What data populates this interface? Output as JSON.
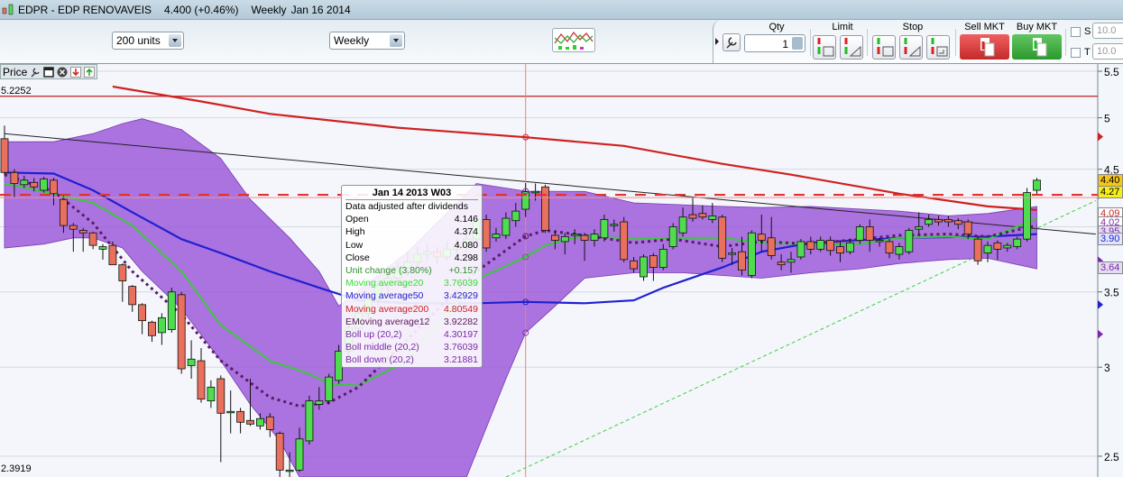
{
  "title": {
    "symbol": "EDPR - EDP RENOVAVEIS",
    "price": "4.400 (+0.46%)",
    "period": "Weekly",
    "date": "Jan 16 2014"
  },
  "toolbar": {
    "units_select": "200 units",
    "period_select": "Weekly",
    "indicators_button": "indicators"
  },
  "trade_panel": {
    "qty_label": "Qty",
    "qty_value": "1",
    "limit_label": "Limit",
    "stop_label": "Stop",
    "sell_label": "Sell MKT",
    "buy_label": "Buy MKT",
    "s_label": "S",
    "t_label": "T",
    "s_value": "10.0",
    "t_value": "10.0"
  },
  "price_panel": {
    "label": "Price",
    "max_label": "5.2252",
    "min_label": "2.3919"
  },
  "tooltip": {
    "header": "Jan 14 2013 W03",
    "note": "Data adjusted after dividends",
    "rows": [
      {
        "label": "Open",
        "value": "4.146",
        "color": "#000000"
      },
      {
        "label": "High",
        "value": "4.374",
        "color": "#000000"
      },
      {
        "label": "Low",
        "value": "4.080",
        "color": "#000000"
      },
      {
        "label": "Close",
        "value": "4.298",
        "color": "#000000"
      },
      {
        "label": "Unit change (3.80%)",
        "value": "+0.157",
        "color": "#2f8f2f"
      },
      {
        "label": "Moving average20",
        "value": "3.76039",
        "color": "#33dd33"
      },
      {
        "label": "Moving average50",
        "value": "3.42929",
        "color": "#2222cc"
      },
      {
        "label": "Moving average200",
        "value": "4.80549",
        "color": "#cc2222"
      },
      {
        "label": "EMoving average12",
        "value": "3.92282",
        "color": "#5a1a5a"
      },
      {
        "label": "Boll up (20,2)",
        "value": "4.30197",
        "color": "#7a2aa8"
      },
      {
        "label": "Boll middle (20,2)",
        "value": "3.76039",
        "color": "#7a2aa8"
      },
      {
        "label": "Boll down (20,2)",
        "value": "3.21881",
        "color": "#7a2aa8"
      }
    ]
  },
  "axis_labels": [
    {
      "text": "4.40",
      "bg": "#f6c51a",
      "color": "#000"
    },
    {
      "text": "4.27",
      "bg": "#f4ee1a",
      "color": "#000"
    },
    {
      "text": "4.09",
      "bg": "#ffffff",
      "color": "#cc2222"
    },
    {
      "text": "4.02",
      "bg": "#ffffff",
      "color": "#7a2aa8"
    },
    {
      "text": "3.95",
      "bg": "#e8dcf4",
      "color": "#7a2aa8"
    },
    {
      "text": "3.90",
      "bg": "#e0e6ff",
      "color": "#2222cc"
    },
    {
      "text": "3.64",
      "bg": "#e4dcf2",
      "color": "#7a2aa8"
    }
  ],
  "chart_data": {
    "type": "candlestick",
    "scale": "log",
    "ylim": [
      2.3919,
      5.58
    ],
    "yticks": [
      5.5,
      5,
      4.5,
      4,
      3.5,
      3,
      2.5
    ],
    "ytick_labels": [
      "5.5",
      "5",
      "4.5",
      "",
      "3.5",
      "3",
      "2.5"
    ],
    "colors": {
      "up": "#4fdc4f",
      "down": "#e8705c",
      "ma20": "#3cc83c",
      "ma50": "#2020d0",
      "ma200": "#d02020",
      "ema12": "#5a1a6a",
      "boll": "#9a55d8",
      "trend": "#222222",
      "support": "#44cc44",
      "level": "#dd3333"
    },
    "crosshair_index": 53,
    "level_price": 4.27,
    "max_line": 5.2252,
    "candles": [
      [
        4.79,
        4.92,
        4.45,
        4.47
      ],
      [
        4.47,
        4.5,
        4.25,
        4.37
      ],
      [
        4.36,
        4.44,
        4.33,
        4.4
      ],
      [
        4.38,
        4.42,
        4.3,
        4.34
      ],
      [
        4.31,
        4.43,
        4.29,
        4.41
      ],
      [
        4.4,
        4.42,
        4.18,
        4.28
      ],
      [
        4.23,
        4.26,
        3.95,
        4.01
      ],
      [
        4.01,
        4.03,
        3.8,
        3.98
      ],
      [
        3.97,
        3.99,
        3.8,
        3.95
      ],
      [
        3.95,
        3.96,
        3.82,
        3.85
      ],
      [
        3.82,
        3.86,
        3.74,
        3.84
      ],
      [
        3.85,
        3.88,
        3.72,
        3.7
      ],
      [
        3.7,
        3.71,
        3.43,
        3.58
      ],
      [
        3.54,
        3.55,
        3.36,
        3.41
      ],
      [
        3.41,
        3.42,
        3.21,
        3.3
      ],
      [
        3.29,
        3.3,
        3.16,
        3.2
      ],
      [
        3.22,
        3.35,
        3.14,
        3.32
      ],
      [
        3.24,
        3.53,
        3.22,
        3.5
      ],
      [
        3.48,
        3.5,
        2.96,
        2.99
      ],
      [
        3.01,
        3.17,
        2.93,
        3.05
      ],
      [
        3.04,
        3.12,
        2.79,
        2.81
      ],
      [
        2.8,
        2.92,
        2.76,
        2.88
      ],
      [
        2.93,
        2.95,
        2.47,
        2.73
      ],
      [
        2.74,
        2.86,
        2.62,
        2.74
      ],
      [
        2.74,
        2.76,
        2.62,
        2.68
      ],
      [
        2.69,
        2.93,
        2.66,
        2.67
      ],
      [
        2.66,
        2.73,
        2.64,
        2.7
      ],
      [
        2.71,
        2.73,
        2.6,
        2.64
      ],
      [
        2.62,
        2.63,
        2.38,
        2.43
      ],
      [
        2.43,
        2.52,
        2.38,
        2.43
      ],
      [
        2.43,
        2.65,
        2.42,
        2.59
      ],
      [
        2.58,
        2.83,
        2.56,
        2.8
      ],
      [
        2.78,
        2.88,
        2.75,
        2.8
      ],
      [
        2.8,
        2.96,
        2.78,
        2.94
      ],
      [
        2.92,
        3.14,
        2.9,
        3.1
      ],
      [
        3.1,
        3.28,
        3.06,
        3.25
      ],
      [
        3.25,
        3.4,
        3.2,
        3.35
      ],
      [
        3.35,
        3.5,
        3.3,
        3.45
      ],
      [
        3.45,
        3.58,
        3.4,
        3.55
      ],
      [
        3.55,
        3.66,
        3.48,
        3.6
      ],
      [
        3.6,
        3.72,
        3.55,
        3.68
      ],
      [
        3.68,
        3.8,
        3.62,
        3.72
      ],
      [
        3.72,
        3.84,
        3.68,
        3.78
      ],
      [
        3.78,
        3.86,
        3.72,
        3.8
      ],
      [
        3.8,
        3.84,
        3.7,
        3.76
      ],
      [
        3.76,
        3.88,
        3.73,
        3.82
      ],
      [
        3.82,
        3.9,
        3.78,
        3.85
      ],
      [
        3.85,
        3.95,
        3.8,
        3.9
      ],
      [
        3.9,
        4.08,
        3.86,
        4.06
      ],
      [
        4.06,
        4.1,
        3.8,
        3.83
      ],
      [
        3.91,
        3.99,
        3.88,
        3.94
      ],
      [
        3.93,
        4.12,
        3.9,
        4.07
      ],
      [
        4.05,
        4.2,
        4.0,
        4.13
      ],
      [
        4.146,
        4.374,
        4.08,
        4.298
      ],
      [
        4.3,
        4.37,
        4.22,
        4.3
      ],
      [
        4.34,
        4.36,
        3.95,
        3.97
      ],
      [
        3.93,
        3.96,
        3.82,
        3.89
      ],
      [
        3.88,
        3.95,
        3.78,
        3.92
      ],
      [
        3.94,
        3.98,
        3.86,
        3.94
      ],
      [
        3.93,
        3.95,
        3.73,
        3.89
      ],
      [
        3.89,
        3.98,
        3.84,
        3.94
      ],
      [
        3.91,
        4.1,
        3.88,
        4.06
      ],
      [
        4.02,
        4.06,
        3.96,
        4.02
      ],
      [
        4.04,
        4.08,
        3.72,
        3.74
      ],
      [
        3.73,
        3.76,
        3.64,
        3.67
      ],
      [
        3.61,
        3.78,
        3.58,
        3.76
      ],
      [
        3.77,
        3.79,
        3.58,
        3.68
      ],
      [
        3.68,
        3.86,
        3.66,
        3.82
      ],
      [
        3.84,
        4.03,
        3.82,
        4.0
      ],
      [
        3.95,
        4.16,
        3.92,
        4.08
      ],
      [
        4.1,
        4.25,
        4.04,
        4.07
      ],
      [
        4.11,
        4.18,
        4.06,
        4.08
      ],
      [
        4.06,
        4.2,
        4.03,
        4.09
      ],
      [
        4.08,
        4.1,
        3.72,
        3.75
      ],
      [
        3.79,
        3.83,
        3.7,
        3.79
      ],
      [
        3.8,
        3.92,
        3.62,
        3.66
      ],
      [
        3.62,
        3.97,
        3.6,
        3.95
      ],
      [
        3.94,
        4.1,
        3.8,
        3.89
      ],
      [
        3.91,
        4.08,
        3.74,
        3.77
      ],
      [
        3.72,
        3.78,
        3.66,
        3.7
      ],
      [
        3.72,
        3.8,
        3.64,
        3.74
      ],
      [
        3.76,
        3.9,
        3.74,
        3.88
      ],
      [
        3.88,
        3.92,
        3.78,
        3.82
      ],
      [
        3.82,
        3.92,
        3.8,
        3.89
      ],
      [
        3.89,
        3.92,
        3.77,
        3.81
      ],
      [
        3.84,
        3.88,
        3.72,
        3.79
      ],
      [
        3.8,
        3.9,
        3.78,
        3.87
      ],
      [
        3.89,
        4.02,
        3.86,
        4.0
      ],
      [
        4.0,
        4.06,
        3.8,
        3.89
      ],
      [
        3.89,
        3.91,
        3.84,
        3.89
      ],
      [
        3.88,
        3.9,
        3.75,
        3.79
      ],
      [
        3.78,
        3.87,
        3.74,
        3.84
      ],
      [
        3.8,
        3.99,
        3.78,
        3.97
      ],
      [
        3.98,
        4.12,
        3.94,
        4.0
      ],
      [
        4.02,
        4.1,
        4.0,
        4.06
      ],
      [
        4.06,
        4.09,
        4.01,
        4.04
      ],
      [
        4.06,
        4.09,
        4.0,
        4.04
      ],
      [
        4.05,
        4.07,
        3.98,
        4.02
      ],
      [
        4.04,
        4.06,
        3.9,
        3.94
      ],
      [
        3.9,
        3.92,
        3.7,
        3.73
      ],
      [
        3.79,
        3.88,
        3.72,
        3.85
      ],
      [
        3.87,
        3.89,
        3.74,
        3.82
      ],
      [
        3.83,
        3.87,
        3.8,
        3.85
      ],
      [
        3.84,
        3.92,
        3.82,
        3.9
      ],
      [
        3.9,
        4.33,
        3.88,
        4.29
      ],
      [
        4.31,
        4.42,
        4.27,
        4.4
      ]
    ],
    "ma200": [
      [
        11,
        5.33
      ],
      [
        20,
        5.17
      ],
      [
        27,
        5.04
      ],
      [
        40,
        4.9
      ],
      [
        53,
        4.805
      ],
      [
        63,
        4.72
      ],
      [
        73,
        4.55
      ],
      [
        80,
        4.45
      ],
      [
        91,
        4.28
      ],
      [
        100,
        4.17
      ],
      [
        105,
        4.14
      ]
    ],
    "ma50": [
      [
        0,
        4.47
      ],
      [
        5,
        4.46
      ],
      [
        9,
        4.31
      ],
      [
        13,
        4.12
      ],
      [
        18,
        3.9
      ],
      [
        22,
        3.79
      ],
      [
        27,
        3.65
      ],
      [
        32,
        3.53
      ],
      [
        36,
        3.44
      ],
      [
        41,
        3.42
      ],
      [
        48,
        3.42
      ],
      [
        53,
        3.429
      ],
      [
        59,
        3.42
      ],
      [
        64,
        3.44
      ],
      [
        67,
        3.53
      ],
      [
        73,
        3.68
      ],
      [
        77,
        3.8
      ],
      [
        82,
        3.87
      ],
      [
        91,
        3.91
      ],
      [
        100,
        3.92
      ],
      [
        105,
        3.94
      ]
    ],
    "ma20": [
      [
        0,
        4.37
      ],
      [
        5,
        4.28
      ],
      [
        9,
        4.2
      ],
      [
        13,
        4.01
      ],
      [
        18,
        3.65
      ],
      [
        22,
        3.27
      ],
      [
        27,
        3.04
      ],
      [
        31,
        2.96
      ],
      [
        33,
        2.9
      ],
      [
        36,
        2.89
      ],
      [
        41,
        3.04
      ],
      [
        48,
        3.59
      ],
      [
        53,
        3.76
      ],
      [
        55,
        3.85
      ],
      [
        59,
        3.93
      ],
      [
        64,
        3.9
      ],
      [
        69,
        3.91
      ],
      [
        73,
        3.91
      ],
      [
        77,
        3.87
      ],
      [
        82,
        3.86
      ],
      [
        87,
        3.86
      ],
      [
        91,
        3.91
      ],
      [
        96,
        3.92
      ],
      [
        100,
        3.9
      ],
      [
        105,
        4.07
      ]
    ],
    "ema12": [
      [
        0,
        4.45
      ],
      [
        5,
        4.3
      ],
      [
        9,
        4.03
      ],
      [
        13,
        3.65
      ],
      [
        18,
        3.34
      ],
      [
        22,
        3.04
      ],
      [
        27,
        2.82
      ],
      [
        30,
        2.77
      ],
      [
        33,
        2.79
      ],
      [
        36,
        2.88
      ],
      [
        48,
        3.65
      ],
      [
        53,
        3.923
      ],
      [
        55,
        3.97
      ],
      [
        59,
        3.93
      ],
      [
        64,
        3.87
      ],
      [
        68,
        3.9
      ],
      [
        73,
        3.84
      ],
      [
        77,
        3.88
      ],
      [
        82,
        3.86
      ],
      [
        87,
        3.9
      ],
      [
        91,
        3.93
      ],
      [
        96,
        3.94
      ],
      [
        100,
        3.92
      ],
      [
        105,
        4.01
      ]
    ],
    "boll_up": [
      [
        0,
        4.76
      ],
      [
        5,
        4.76
      ],
      [
        9,
        4.84
      ],
      [
        12,
        4.94
      ],
      [
        14,
        4.99
      ],
      [
        18,
        4.88
      ],
      [
        22,
        4.6
      ],
      [
        25,
        4.23
      ],
      [
        29,
        3.91
      ],
      [
        32,
        3.65
      ],
      [
        34,
        3.4
      ],
      [
        41,
        3.8
      ],
      [
        48,
        4.37
      ],
      [
        53,
        4.302
      ],
      [
        59,
        4.3
      ],
      [
        64,
        4.2
      ],
      [
        73,
        4.17
      ],
      [
        77,
        4.16
      ],
      [
        82,
        4.17
      ],
      [
        91,
        4.13
      ],
      [
        96,
        4.09
      ],
      [
        100,
        4.11
      ],
      [
        105,
        4.17
      ]
    ],
    "boll_down": [
      [
        0,
        3.83
      ],
      [
        4,
        3.86
      ],
      [
        7,
        3.91
      ],
      [
        9,
        3.91
      ],
      [
        12,
        3.83
      ],
      [
        14,
        3.65
      ],
      [
        18,
        3.38
      ],
      [
        22,
        3.04
      ],
      [
        25,
        2.78
      ],
      [
        28,
        2.58
      ],
      [
        30,
        2.39
      ],
      [
        34,
        2.26
      ],
      [
        41,
        2.1
      ],
      [
        47,
        2.39
      ],
      [
        51,
        2.93
      ],
      [
        53,
        3.219
      ],
      [
        56,
        3.4
      ],
      [
        59,
        3.6
      ],
      [
        64,
        3.64
      ],
      [
        69,
        3.64
      ],
      [
        73,
        3.62
      ],
      [
        77,
        3.6
      ],
      [
        82,
        3.64
      ],
      [
        87,
        3.67
      ],
      [
        91,
        3.71
      ],
      [
        96,
        3.74
      ],
      [
        100,
        3.75
      ],
      [
        105,
        3.67
      ]
    ],
    "trendline": [
      [
        0,
        4.84
      ],
      [
        111,
        3.94
      ]
    ],
    "support_line": [
      [
        51,
        2.39
      ],
      [
        111,
        4.22
      ]
    ],
    "markers": [
      {
        "price": 4.81,
        "color": "#cc2222"
      },
      {
        "price": 4.27,
        "color": "#7a2aa8"
      },
      {
        "price": 3.93,
        "color": "#5a1a5a"
      },
      {
        "price": 3.73,
        "color": "#7a2aa8"
      },
      {
        "price": 3.41,
        "color": "#2222cc"
      },
      {
        "price": 3.21,
        "color": "#7a2aa8"
      }
    ]
  }
}
